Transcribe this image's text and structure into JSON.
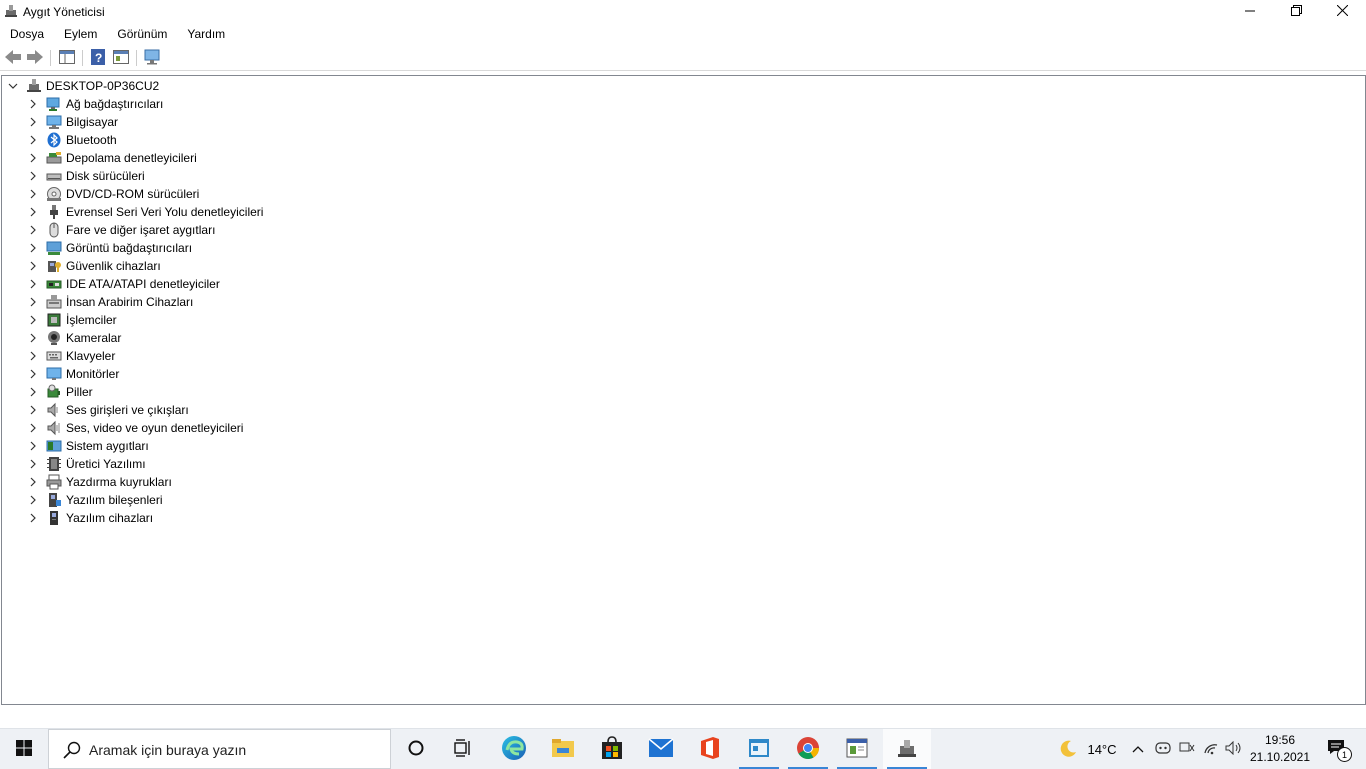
{
  "window": {
    "title": "Aygıt Yöneticisi"
  },
  "menu": [
    "Dosya",
    "Eylem",
    "Görünüm",
    "Yardım"
  ],
  "tree": {
    "root": "DESKTOP-0P36CU2",
    "items": [
      {
        "label": "Ağ bağdaştırıcıları",
        "icon": "network-adapter-icon"
      },
      {
        "label": "Bilgisayar",
        "icon": "computer-icon"
      },
      {
        "label": "Bluetooth",
        "icon": "bluetooth-icon"
      },
      {
        "label": "Depolama denetleyicileri",
        "icon": "storage-controller-icon"
      },
      {
        "label": "Disk sürücüleri",
        "icon": "disk-drive-icon"
      },
      {
        "label": "DVD/CD-ROM sürücüleri",
        "icon": "dvd-icon"
      },
      {
        "label": "Evrensel Seri Veri Yolu denetleyicileri",
        "icon": "usb-icon"
      },
      {
        "label": "Fare ve diğer işaret aygıtları",
        "icon": "mouse-icon"
      },
      {
        "label": "Görüntü bağdaştırıcıları",
        "icon": "display-adapter-icon"
      },
      {
        "label": "Güvenlik cihazları",
        "icon": "security-device-icon"
      },
      {
        "label": "IDE ATA/ATAPI denetleyiciler",
        "icon": "ide-icon"
      },
      {
        "label": "İnsan Arabirim Cihazları",
        "icon": "hid-icon"
      },
      {
        "label": "İşlemciler",
        "icon": "processor-icon"
      },
      {
        "label": "Kameralar",
        "icon": "camera-icon"
      },
      {
        "label": "Klavyeler",
        "icon": "keyboard-icon"
      },
      {
        "label": "Monitörler",
        "icon": "monitor-icon"
      },
      {
        "label": "Piller",
        "icon": "battery-icon"
      },
      {
        "label": "Ses girişleri ve çıkışları",
        "icon": "speaker-icon"
      },
      {
        "label": "Ses, video ve oyun denetleyicileri",
        "icon": "sound-controller-icon"
      },
      {
        "label": "Sistem aygıtları",
        "icon": "system-devices-icon"
      },
      {
        "label": "Üretici Yazılımı",
        "icon": "firmware-icon"
      },
      {
        "label": "Yazdırma kuyrukları",
        "icon": "printer-icon"
      },
      {
        "label": "Yazılım bileşenleri",
        "icon": "software-component-icon"
      },
      {
        "label": "Yazılım cihazları",
        "icon": "software-device-icon"
      }
    ]
  },
  "taskbar": {
    "search_placeholder": "Aramak için buraya yazın",
    "weather": "14°C",
    "time": "19:56",
    "date": "21.10.2021",
    "notification_count": "1"
  },
  "colors": {
    "accent": "#3a86d6",
    "folder": "#f2c94c"
  }
}
